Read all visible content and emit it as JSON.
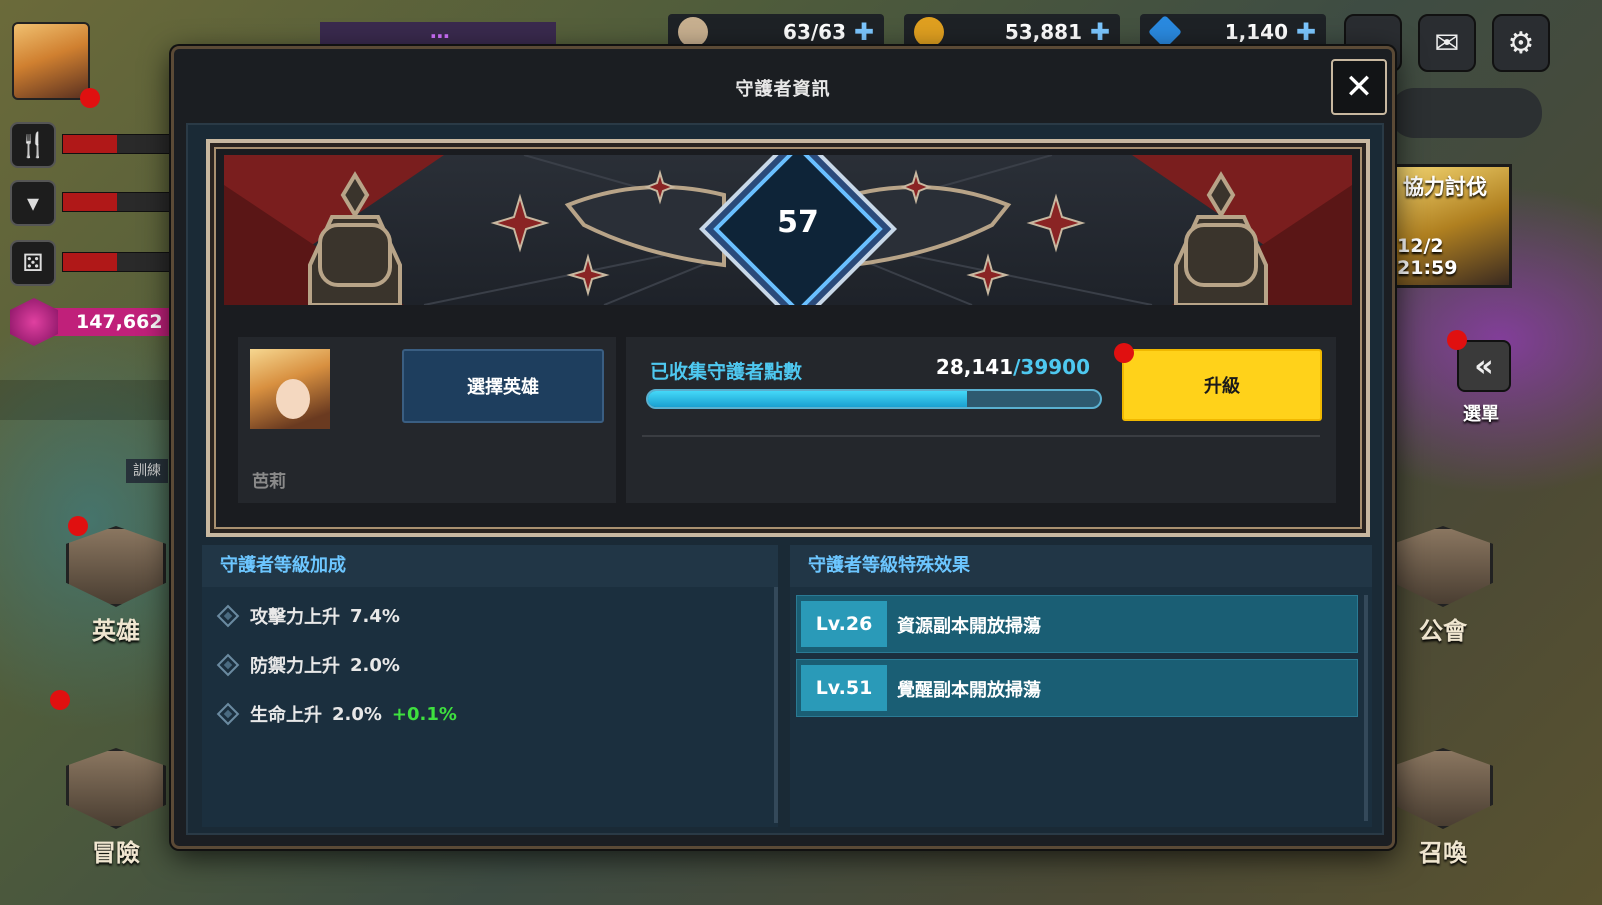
{
  "resources": {
    "stamina": "63/63",
    "gold": "53,881",
    "diamonds": "1,140"
  },
  "hud": {
    "gem_count": "147,662",
    "train_label": "訓練",
    "hero_label": "英雄",
    "adventure_label": "冒險",
    "guild_label": "公會",
    "summon_label": "召喚",
    "menu_label": "選單",
    "raid_title": "協力討伐",
    "raid_time": "12/2 21:59"
  },
  "modal": {
    "title": "守護者資訊",
    "close_icon": "close-icon",
    "level": "57",
    "select_hero_label": "選擇英雄",
    "hero_name": "芭莉",
    "points_label": "已收集守護者點數",
    "points_current": "28,141",
    "points_max": "/39900",
    "points_progress": 0.705,
    "upgrade_label": "升級"
  },
  "bonus": {
    "title": "守護者等級加成",
    "stats": [
      {
        "label": "攻擊力上升",
        "value": "7.4%",
        "bonus": ""
      },
      {
        "label": "防禦力上升",
        "value": "2.0%",
        "bonus": ""
      },
      {
        "label": "生命上升",
        "value": "2.0%",
        "bonus": "+0.1%"
      }
    ]
  },
  "effects": {
    "title": "守護者等級特殊效果",
    "items": [
      {
        "level": "Lv.26",
        "text": "資源副本開放掃蕩"
      },
      {
        "level": "Lv.51",
        "text": "覺醒副本開放掃蕩"
      }
    ]
  },
  "colors": {
    "accent_cyan": "#4ec8f0",
    "upgrade_yellow": "#ffd21a",
    "bonus_green": "#3ee03e"
  }
}
